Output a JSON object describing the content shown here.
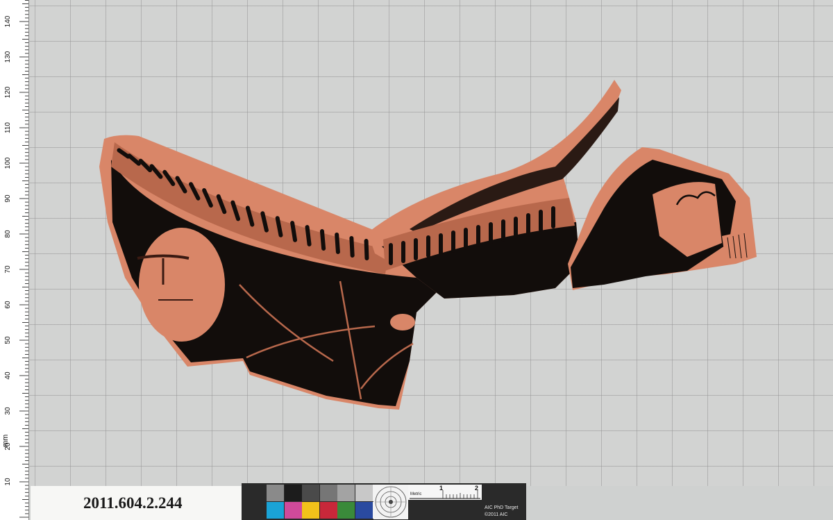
{
  "ruler": {
    "unit": "mm",
    "labels": [
      "10",
      "20",
      "30",
      "40",
      "50",
      "60",
      "70",
      "80",
      "90",
      "100",
      "110",
      "120",
      "130",
      "140"
    ]
  },
  "label": {
    "accession": "2011.604.2.244"
  },
  "target": {
    "metric_label": "Metric",
    "scale_1": "1",
    "scale_2": "2",
    "title": "AIC PhD Target",
    "copyright": "©2011 AIC",
    "top_colors": [
      "#8a8a8a",
      "#1c1c1c",
      "#4a4a4a",
      "#767676",
      "#a3a3a3",
      "#c8c8c8",
      "#f0f0f0"
    ],
    "bottom_colors": [
      "#1aa3d6",
      "#d04a9a",
      "#f2c21a",
      "#c8283a",
      "#3a8a3a",
      "#2a4aa0",
      "#f0f0f0"
    ]
  },
  "colors": {
    "clay": "#d9876a",
    "glaze": "#120d0b",
    "grid": "#d2d3d2"
  }
}
